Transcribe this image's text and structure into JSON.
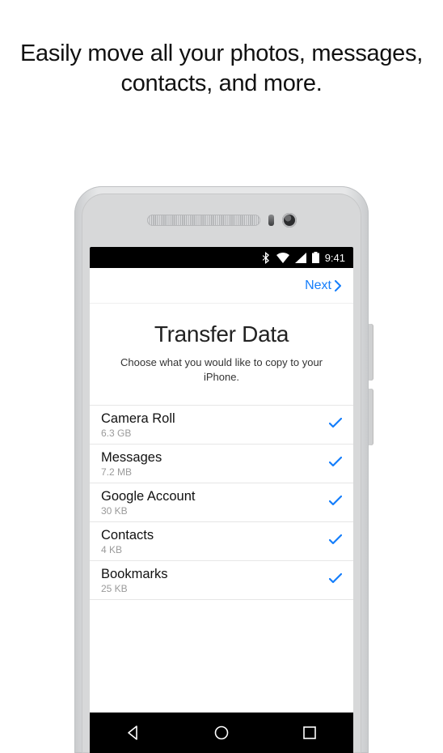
{
  "headline": "Easily move all your photos, messages, contacts, and more.",
  "status": {
    "time": "9:41"
  },
  "topbar": {
    "next_label": "Next"
  },
  "screen": {
    "title": "Transfer Data",
    "subtitle": "Choose what you would like to copy to your iPhone."
  },
  "items": [
    {
      "label": "Camera Roll",
      "size": "6.3 GB"
    },
    {
      "label": "Messages",
      "size": "7.2 MB"
    },
    {
      "label": "Google Account",
      "size": "30 KB"
    },
    {
      "label": "Contacts",
      "size": "4 KB"
    },
    {
      "label": "Bookmarks",
      "size": "25 KB"
    }
  ]
}
